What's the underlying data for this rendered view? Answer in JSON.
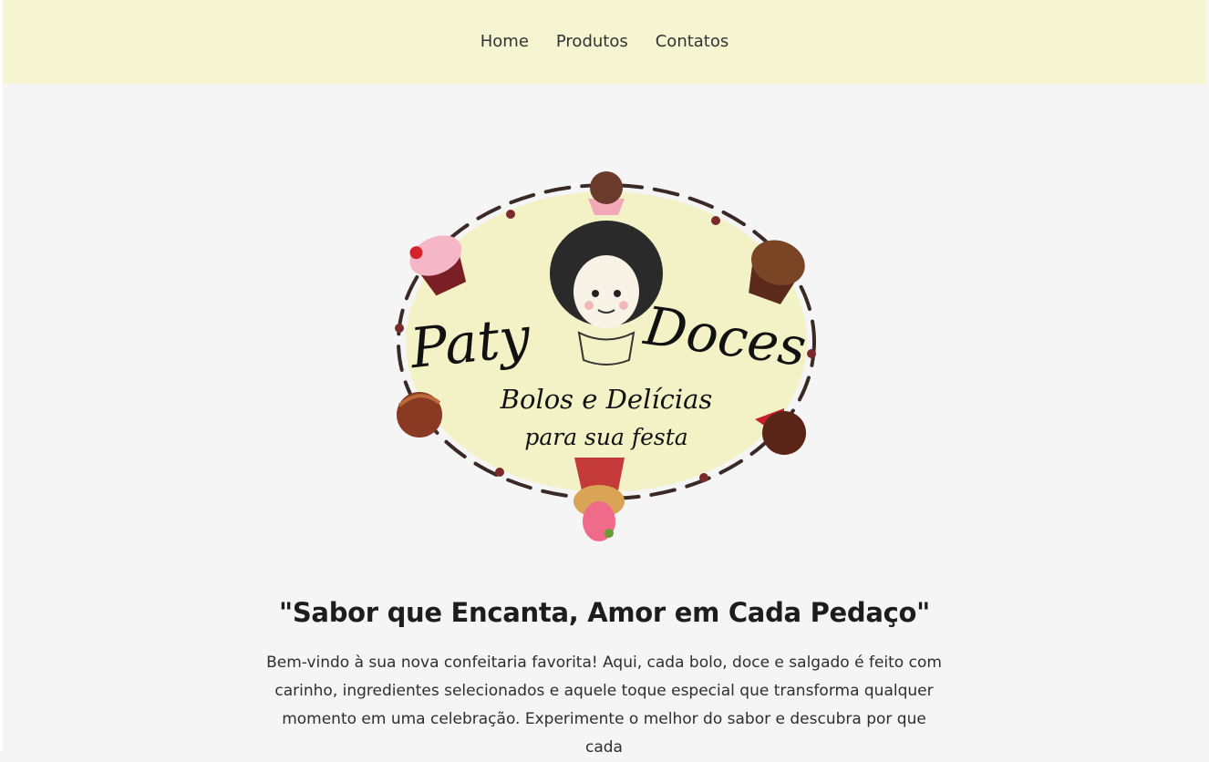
{
  "nav": {
    "items": [
      {
        "label": "Home"
      },
      {
        "label": "Produtos"
      },
      {
        "label": "Contatos"
      }
    ]
  },
  "logo": {
    "name_left": "Paty",
    "name_right": "Doces",
    "tagline_1": "Bolos e Delícias",
    "tagline_2": "para sua festa"
  },
  "hero": {
    "slogan": "\"Sabor que Encanta, Amor em Cada Pedaço\"",
    "intro": "Bem-vindo à sua nova confeitaria favorita! Aqui, cada bolo, doce e salgado é feito com carinho, ingredientes selecionados e aquele toque especial que transforma qualquer momento em uma celebração. Experimente o melhor do sabor e descubra por que cada"
  },
  "colors": {
    "navbar_bg": "#f5f5d2",
    "page_bg": "#f5f5f5",
    "logo_oval": "#f3f2c6"
  }
}
